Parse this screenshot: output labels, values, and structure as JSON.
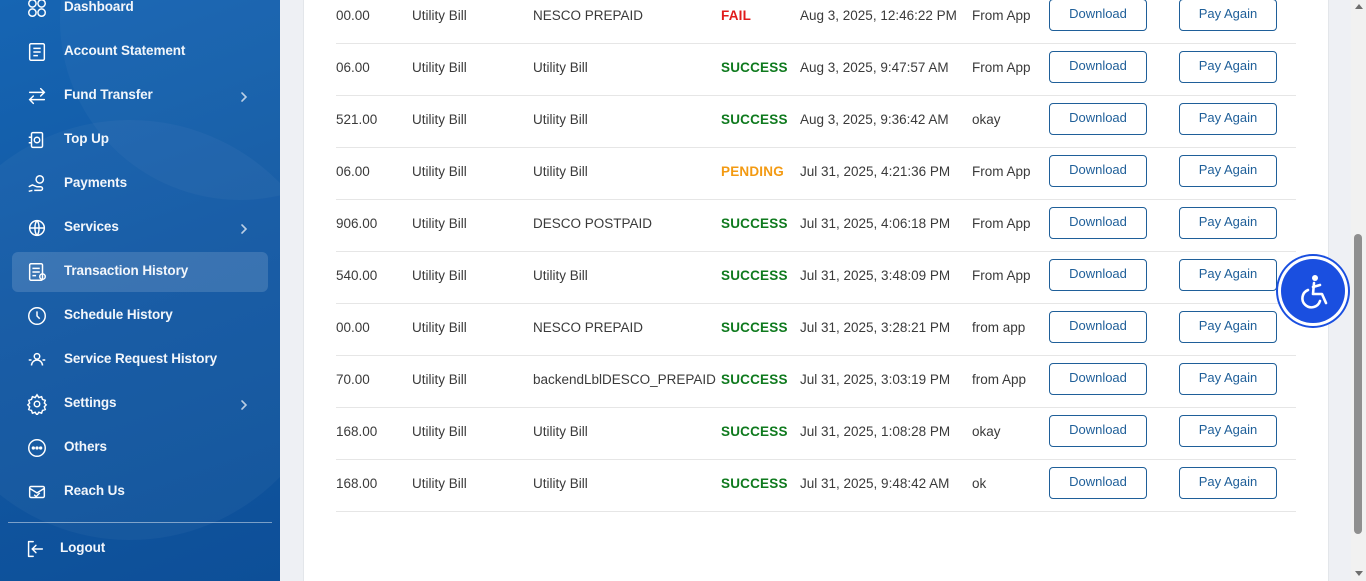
{
  "sidebar": {
    "items": [
      {
        "label": "Dashboard",
        "icon": "dashboard-icon",
        "chevron": false,
        "active": false
      },
      {
        "label": "Account Statement",
        "icon": "account-statement-icon",
        "chevron": false,
        "active": false
      },
      {
        "label": "Fund Transfer",
        "icon": "fund-transfer-icon",
        "chevron": true,
        "active": false
      },
      {
        "label": "Top Up",
        "icon": "top-up-icon",
        "chevron": false,
        "active": false
      },
      {
        "label": "Payments",
        "icon": "payments-icon",
        "chevron": false,
        "active": false
      },
      {
        "label": "Services",
        "icon": "services-icon",
        "chevron": true,
        "active": false
      },
      {
        "label": "Transaction History",
        "icon": "transaction-history-icon",
        "chevron": false,
        "active": true
      },
      {
        "label": "Schedule History",
        "icon": "clock-icon",
        "chevron": false,
        "active": false
      },
      {
        "label": "Service Request History",
        "icon": "service-request-icon",
        "chevron": false,
        "active": false
      },
      {
        "label": "Settings",
        "icon": "gear-icon",
        "chevron": true,
        "active": false
      },
      {
        "label": "Others",
        "icon": "more-icon",
        "chevron": false,
        "active": false
      },
      {
        "label": "Reach Us",
        "icon": "reach-us-icon",
        "chevron": false,
        "active": false
      }
    ],
    "logout_label": "Logout"
  },
  "transactions": {
    "download_label": "Download",
    "pay_again_label": "Pay Again",
    "rows": [
      {
        "amount": "00.00",
        "type": "Utility Bill",
        "biller": "NESCO PREPAID",
        "status": "FAIL",
        "datetime": "Aug 3, 2025, 12:46:22 PM",
        "remarks": "From App"
      },
      {
        "amount": "06.00",
        "type": "Utility Bill",
        "biller": "Utility Bill",
        "status": "SUCCESS",
        "datetime": "Aug 3, 2025, 9:47:57 AM",
        "remarks": "From App"
      },
      {
        "amount": "521.00",
        "type": "Utility Bill",
        "biller": "Utility Bill",
        "status": "SUCCESS",
        "datetime": "Aug 3, 2025, 9:36:42 AM",
        "remarks": "okay"
      },
      {
        "amount": "06.00",
        "type": "Utility Bill",
        "biller": "Utility Bill",
        "status": "PENDING",
        "datetime": "Jul 31, 2025, 4:21:36 PM",
        "remarks": "From App"
      },
      {
        "amount": "906.00",
        "type": "Utility Bill",
        "biller": "DESCO POSTPAID",
        "status": "SUCCESS",
        "datetime": "Jul 31, 2025, 4:06:18 PM",
        "remarks": "From App"
      },
      {
        "amount": "540.00",
        "type": "Utility Bill",
        "biller": "Utility Bill",
        "status": "SUCCESS",
        "datetime": "Jul 31, 2025, 3:48:09 PM",
        "remarks": "From App"
      },
      {
        "amount": "00.00",
        "type": "Utility Bill",
        "biller": "NESCO PREPAID",
        "status": "SUCCESS",
        "datetime": "Jul 31, 2025, 3:28:21 PM",
        "remarks": "from app"
      },
      {
        "amount": "70.00",
        "type": "Utility Bill",
        "biller": "backendLblDESCO_PREPAID",
        "status": "SUCCESS",
        "datetime": "Jul 31, 2025, 3:03:19 PM",
        "remarks": "from App"
      },
      {
        "amount": "168.00",
        "type": "Utility Bill",
        "biller": "Utility Bill",
        "status": "SUCCESS",
        "datetime": "Jul 31, 2025, 1:08:28 PM",
        "remarks": "okay"
      },
      {
        "amount": "168.00",
        "type": "Utility Bill",
        "biller": "Utility Bill",
        "status": "SUCCESS",
        "datetime": "Jul 31, 2025, 9:48:42 AM",
        "remarks": "ok"
      }
    ]
  },
  "accessibility_button": {
    "icon": "accessibility-icon"
  },
  "colors": {
    "sidebar": "#1259a4",
    "success": "#0f7a1e",
    "fail": "#e11b1b",
    "pending": "#f39a12",
    "button_border": "#1f5f99",
    "accessibility": "#1a4fe0"
  }
}
